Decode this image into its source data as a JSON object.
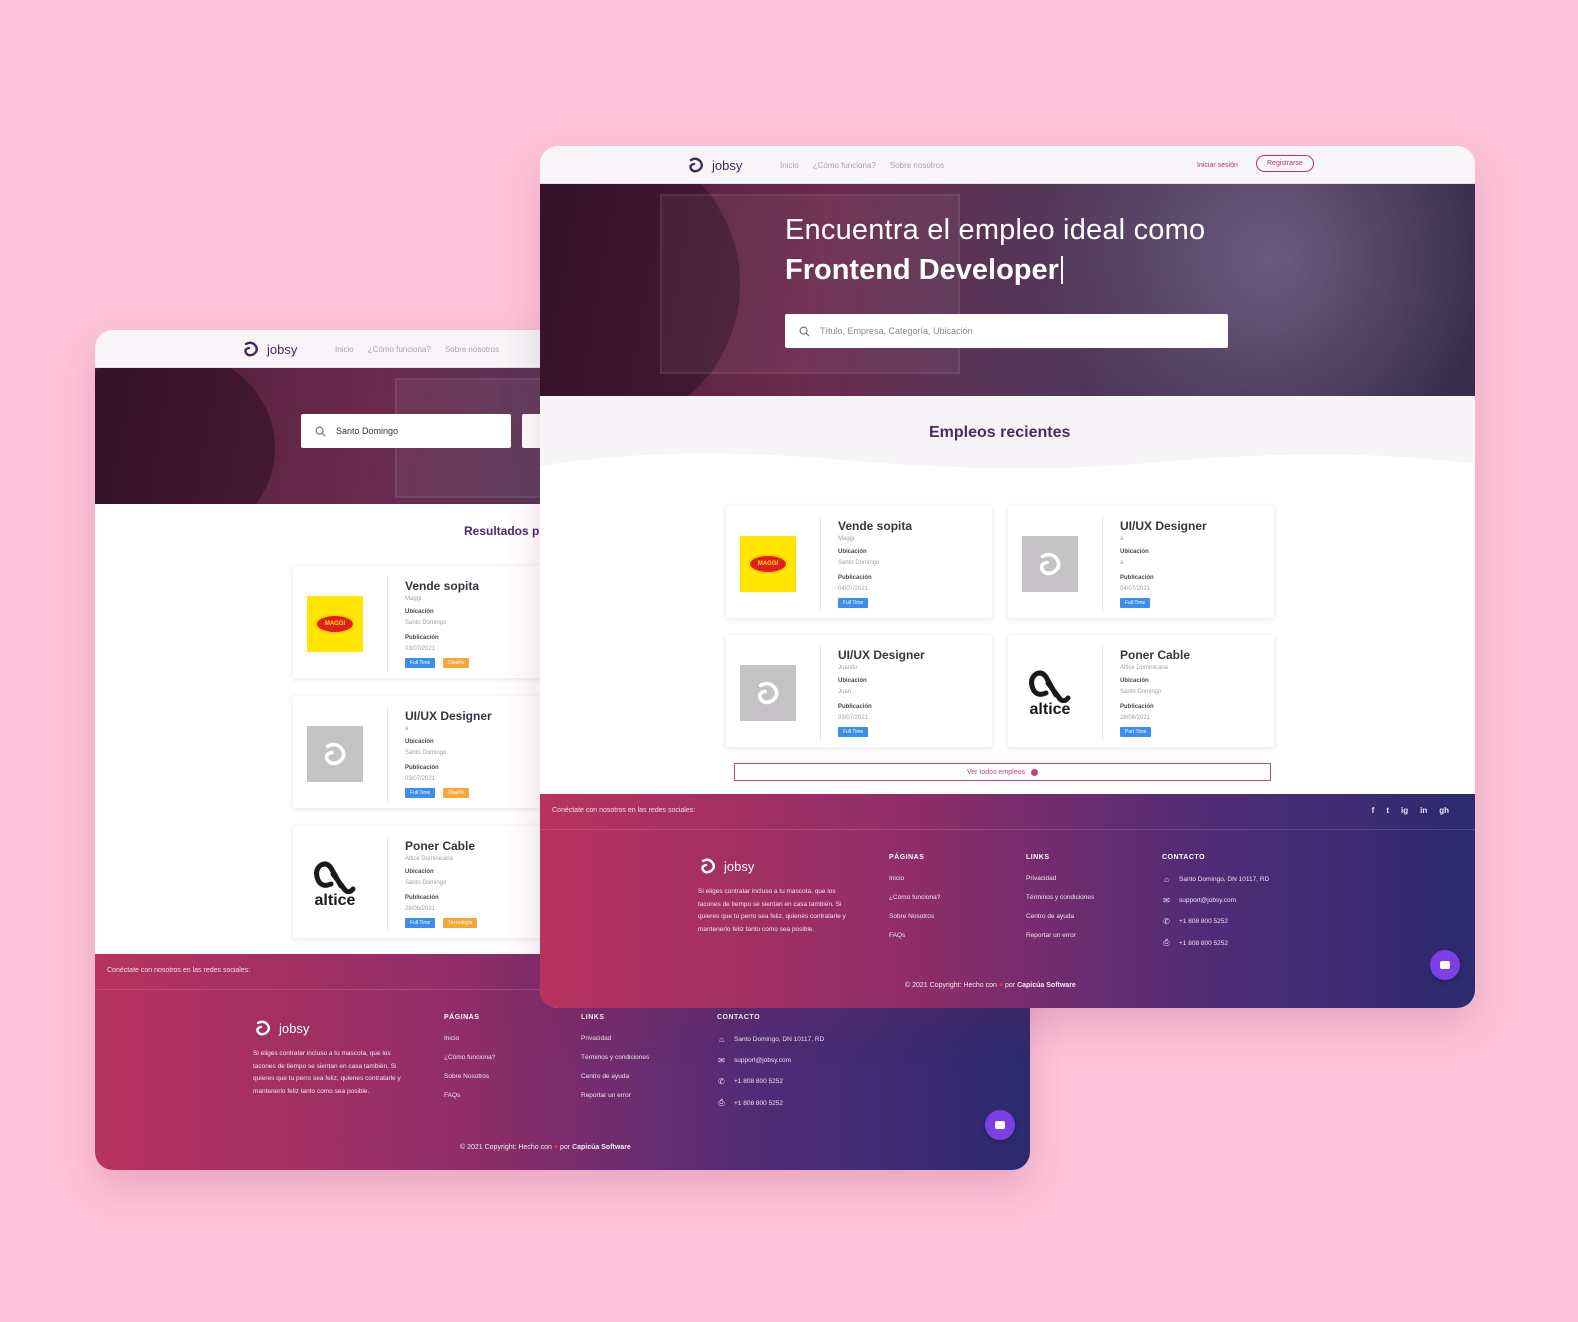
{
  "brand": {
    "name": "jobsy"
  },
  "nav": {
    "links": [
      "Inicio",
      "¿Cómo funciona?",
      "Sobre nosotros"
    ],
    "login": "Iniciar sesión",
    "register": "Registrarse"
  },
  "back_window": {
    "search_value": "Santo Domingo",
    "section_title": "Resultados p",
    "jobs": [
      {
        "title": "Vende sopita",
        "company": "Maggi",
        "location_label": "Ubicación",
        "location": "Santo Domingo",
        "date_label": "Publicación",
        "date": "03/07/2021",
        "tags": [
          "Full Time",
          "Diseño"
        ],
        "logo": "maggi-logo"
      },
      {
        "title": "UI/UX Designer",
        "company": "a",
        "location_label": "Ubicación",
        "location": "Santo Domingo",
        "date_label": "Publicación",
        "date": "03/07/2021",
        "tags": [
          "Full Time",
          "Diseño"
        ],
        "logo": "jobsy-placeholder-logo"
      },
      {
        "title": "Poner Cable",
        "company": "Altice Dominicana",
        "location_label": "Ubicación",
        "location": "Santo Domingo",
        "date_label": "Publicación",
        "date": "28/06/2021",
        "tags": [
          "Full Time",
          "Tecnología"
        ],
        "logo": "altice-logo"
      }
    ]
  },
  "front_window": {
    "hero_title": "Encuentra el empleo ideal como",
    "hero_role": "Frontend Developer",
    "search_placeholder": "Título, Empresa, Categoría, Ubicación",
    "section_title": "Empleos recientes",
    "jobs": [
      {
        "title": "Vende sopita",
        "company": "Maggi",
        "location_label": "Ubicación",
        "location": "Santo Domingo",
        "date_label": "Publicación",
        "date": "04/07/2021",
        "tags": [
          "Full Time"
        ],
        "logo": "maggi-logo"
      },
      {
        "title": "UI/UX Designer",
        "company": "a",
        "location_label": "Ubicación",
        "location": "a",
        "date_label": "Publicación",
        "date": "04/07/2021",
        "tags": [
          "Full Time"
        ],
        "logo": "jobsy-placeholder-logo"
      },
      {
        "title": "UI/UX Designer",
        "company": "Juanito",
        "location_label": "Ubicación",
        "location": "Juan",
        "date_label": "Publicación",
        "date": "03/07/2021",
        "tags": [
          "Full Time"
        ],
        "logo": "jobsy-placeholder-logo"
      },
      {
        "title": "Poner Cable",
        "company": "Altice Dominicana",
        "location_label": "Ubicación",
        "location": "Santo Domingo",
        "date_label": "Publicación",
        "date": "28/06/2021",
        "tags": [
          "Part Time"
        ],
        "logo": "altice-logo"
      }
    ],
    "see_all": "Ver todos empleos"
  },
  "footer": {
    "social_text": "Conéctate con nosotros en las redes sociales:",
    "socials": [
      "f",
      "t",
      "ig",
      "in",
      "gh"
    ],
    "description": "Si eliges contratar incluso a tu mascota, que los tacones de tiempo se sientan en casa también. Si quieres que tu perro sea feliz, quienes contratarle y mantenerlo feliz tanto como sea posible.",
    "pages_heading": "PÁGINAS",
    "pages": [
      "Inicio",
      "¿Cómo funciona?",
      "Sobre Nosotros",
      "FAQs"
    ],
    "links_heading": "LINKS",
    "links": [
      "Privacidad",
      "Términos y condiciones",
      "Centro de ayuda",
      "Reportar un error"
    ],
    "contact_heading": "CONTACTO",
    "contact": [
      {
        "icon": "home-icon",
        "text": "Santo Domingo, DN 10117, RD"
      },
      {
        "icon": "envelope-icon",
        "text": "support@jobsy.com"
      },
      {
        "icon": "phone-icon",
        "text": "+1 808 800 5252"
      },
      {
        "icon": "print-icon",
        "text": "+1 808 800 5252"
      }
    ],
    "copyright_prefix": "© 2021 Copyright: Hecho con",
    "copyright_by": "por",
    "copyright_company": "Capicúa Software"
  },
  "colors": {
    "background": "#ffc4d9",
    "accent": "#c0447c",
    "heading": "#4a2a6a",
    "tag_blue": "#3b8ef0",
    "tag_orange": "#f2a83a",
    "chat": "#7b3fe4"
  }
}
